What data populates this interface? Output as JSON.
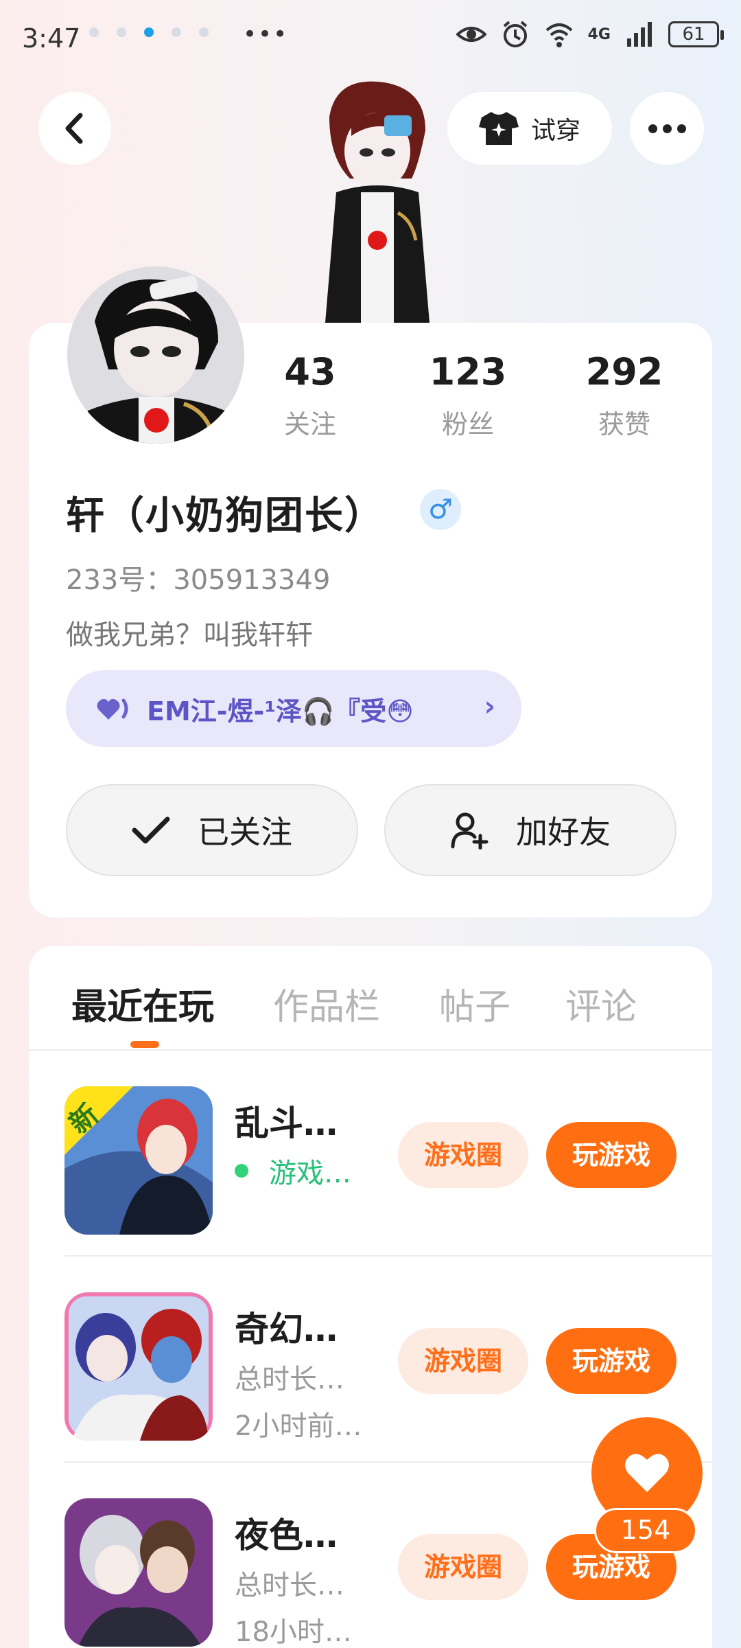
{
  "status_bar": {
    "time": "3:47",
    "more": "•••",
    "network": "4G",
    "battery": "61"
  },
  "header": {
    "try_on_label": "试穿"
  },
  "profile": {
    "stats": [
      {
        "value": "43",
        "label": "关注"
      },
      {
        "value": "123",
        "label": "粉丝"
      },
      {
        "value": "292",
        "label": "获赞"
      }
    ],
    "nickname": "轩（小奶狗团长）",
    "gender_symbol": "♂",
    "id_line": "233号：305913349",
    "bio": "做我兄弟？叫我轩轩",
    "cp_badge": "EM江-煜-¹泽🎧『受😳",
    "follow_label": "已关注",
    "add_friend_label": "加好友"
  },
  "tabs": [
    {
      "label": "最近在玩",
      "active": true
    },
    {
      "label": "作品栏",
      "active": false
    },
    {
      "label": "帖子",
      "active": false
    },
    {
      "label": "评论",
      "active": false
    }
  ],
  "games": [
    {
      "name": "乱斗…",
      "line1": "游戏…",
      "line2": "",
      "online": true,
      "circle_label": "游戏圈",
      "play_label": "玩游戏",
      "icon_badge": "新"
    },
    {
      "name": "奇幻…",
      "line1": "总时长…",
      "line2": "2小时前…",
      "online": false,
      "circle_label": "游戏圈",
      "play_label": "玩游戏"
    },
    {
      "name": "夜色…",
      "line1": "总时长…",
      "line2": "18小时…",
      "online": false,
      "circle_label": "游戏圈",
      "play_label": "玩游戏"
    }
  ],
  "like": {
    "count": "154"
  },
  "colors": {
    "accent": "#ff6f12",
    "accent_light": "#fdeae0",
    "online_green": "#27c07a",
    "badge_purple": "#5d55c6"
  }
}
